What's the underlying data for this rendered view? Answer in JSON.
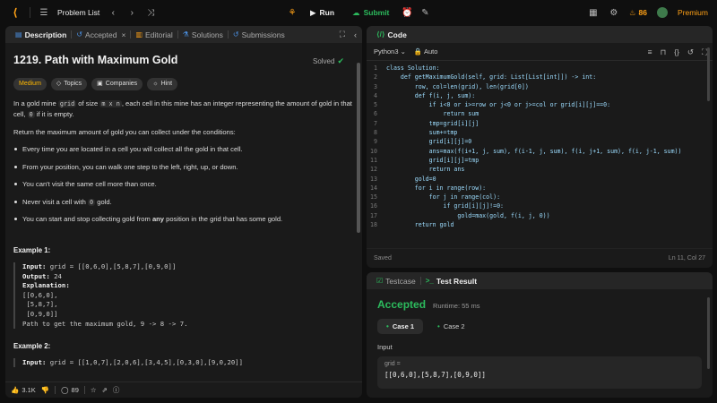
{
  "topbar": {
    "problem_list": "Problem List",
    "run_label": "Run",
    "submit_label": "Submit",
    "streak": "86",
    "premium": "Premium"
  },
  "left_tabs": [
    {
      "label": "Description",
      "icon": "document-icon"
    },
    {
      "label": "Accepted",
      "icon": "history-icon"
    },
    {
      "label": "Editorial",
      "icon": "book-icon"
    },
    {
      "label": "Solutions",
      "icon": "flask-icon"
    },
    {
      "label": "Submissions",
      "icon": "history-icon"
    }
  ],
  "problem": {
    "title": "1219. Path with Maximum Gold",
    "status": "Solved",
    "difficulty": "Medium",
    "chips": [
      "Topics",
      "Companies",
      "Hint"
    ],
    "intro_1": "In a gold mine ",
    "intro_code_1": "grid",
    "intro_2": " of size ",
    "intro_code_2": "m x n",
    "intro_3": ", each cell in this mine has an integer representing the amount of gold in that cell, ",
    "intro_code_3": "0",
    "intro_4": " if it is empty.",
    "return_text": "Return the maximum amount of gold you can collect under the conditions:",
    "bullet_1": "Every time you are located in a cell you will collect all the gold in that cell.",
    "bullet_2": "From your position, you can walk one step to the left, right, up, or down.",
    "bullet_3": "You can't visit the same cell more than once.",
    "bullet_4a": "Never visit a cell with ",
    "bullet_4code": "0",
    "bullet_4b": " gold.",
    "bullet_5a": "You can start and stop collecting gold from ",
    "bullet_5b": "any",
    "bullet_5c": " position in the grid that has some gold.",
    "example1_title": "Example 1:",
    "example1_input_label": "Input:",
    "example1_input": " grid = [[0,6,0],[5,8,7],[0,9,0]]",
    "example1_output_label": "Output:",
    "example1_output": " 24",
    "example1_expl_label": "Explanation:",
    "example1_expl_lines": [
      "[[0,6,0],",
      " [5,8,7],",
      " [0,9,0]]",
      "Path to get the maximum gold, 9 -> 8 -> 7."
    ],
    "example2_title": "Example 2:",
    "example2_input_label": "Input:",
    "example2_input": " grid = [[1,0,7],[2,0,6],[3,4,5],[0,3,0],[9,0,20]]"
  },
  "bottom_bar": {
    "likes": "3.1K",
    "comments": "89"
  },
  "editor": {
    "header": "Code",
    "language": "Python3",
    "mode": "Auto",
    "lines": [
      "class Solution:",
      "    def getMaximumGold(self, grid: List[List[int]]) -> int:",
      "        row, col=len(grid), len(grid[0])",
      "        def f(i, j, sum):",
      "            if i<0 or i>=row or j<0 or j>=col or grid[i][j]==0:",
      "                return sum",
      "            tmp=grid[i][j]",
      "            sum+=tmp",
      "            grid[i][j]=0",
      "            ans=max(f(i+1, j, sum), f(i-1, j, sum), f(i, j+1, sum), f(i, j-1, sum))",
      "            grid[i][j]=tmp",
      "            return ans",
      "        gold=0",
      "        for i in range(row):",
      "            for j in range(col):",
      "                if grid[i][j]!=0:",
      "                    gold=max(gold, f(i, j, 0))",
      "        return gold"
    ],
    "saved": "Saved",
    "cursor": "Ln 11, Col 27"
  },
  "result": {
    "tab_testcase": "Testcase",
    "tab_result": "Test Result",
    "status": "Accepted",
    "runtime": "Runtime: 55 ms",
    "cases": [
      "Case 1",
      "Case 2"
    ],
    "input_label": "Input",
    "input_name": "grid =",
    "input_value": "[[0,6,0],[5,8,7],[0,9,0]]"
  },
  "colors": {
    "accent": "#ffa116",
    "success": "#2cbb5d",
    "medium": "#ffb800"
  }
}
